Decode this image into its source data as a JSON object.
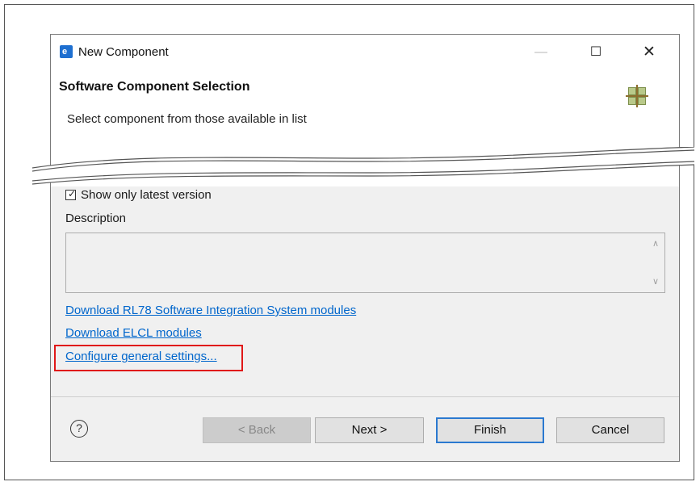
{
  "window": {
    "title": "New Component",
    "min_glyph": "—",
    "max_glyph": "☐",
    "close_glyph": "✕",
    "app_icon_letter": "e"
  },
  "header": {
    "title": "Software Component Selection",
    "description": "Select component from those available in list"
  },
  "options": {
    "show_latest_label": "Show only latest version",
    "show_latest_checked": true,
    "check_glyph": "✓"
  },
  "description": {
    "label": "Description",
    "value": "",
    "scroll_up_glyph": "∧",
    "scroll_down_glyph": "∨"
  },
  "links": [
    {
      "label": "Download RL78 Software Integration System modules"
    },
    {
      "label": "Download ELCL modules"
    },
    {
      "label": "Configure general settings..."
    }
  ],
  "buttons": {
    "help_glyph": "?",
    "back": "< Back",
    "next": "Next >",
    "finish": "Finish",
    "cancel": "Cancel"
  },
  "colors": {
    "link": "#0066cc",
    "highlight": "#e01818",
    "default_button_border": "#2b79d0"
  }
}
